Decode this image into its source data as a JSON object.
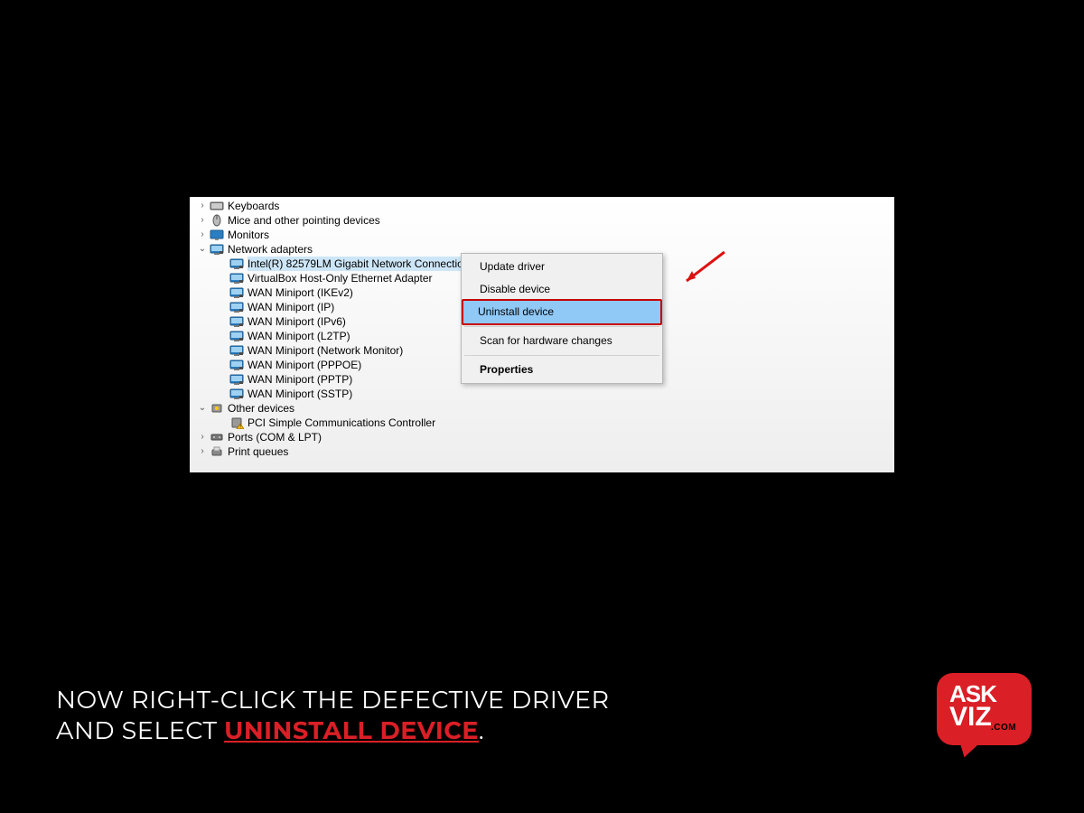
{
  "tree": {
    "items": [
      {
        "label": "Keyboards",
        "expander": "›",
        "indent": 0,
        "icon": "keyboard"
      },
      {
        "label": "Mice and other pointing devices",
        "expander": "›",
        "indent": 0,
        "icon": "mouse"
      },
      {
        "label": "Monitors",
        "expander": "›",
        "indent": 0,
        "icon": "monitor"
      },
      {
        "label": "Network adapters",
        "expander": "⌄",
        "indent": 0,
        "icon": "network"
      },
      {
        "label": "Intel(R) 82579LM Gigabit Network Connection",
        "expander": "",
        "indent": 1,
        "icon": "network",
        "selected": true
      },
      {
        "label": "VirtualBox Host-Only Ethernet Adapter",
        "expander": "",
        "indent": 1,
        "icon": "network"
      },
      {
        "label": "WAN Miniport (IKEv2)",
        "expander": "",
        "indent": 1,
        "icon": "network"
      },
      {
        "label": "WAN Miniport (IP)",
        "expander": "",
        "indent": 1,
        "icon": "network"
      },
      {
        "label": "WAN Miniport (IPv6)",
        "expander": "",
        "indent": 1,
        "icon": "network"
      },
      {
        "label": "WAN Miniport (L2TP)",
        "expander": "",
        "indent": 1,
        "icon": "network"
      },
      {
        "label": "WAN Miniport (Network Monitor)",
        "expander": "",
        "indent": 1,
        "icon": "network"
      },
      {
        "label": "WAN Miniport (PPPOE)",
        "expander": "",
        "indent": 1,
        "icon": "network"
      },
      {
        "label": "WAN Miniport (PPTP)",
        "expander": "",
        "indent": 1,
        "icon": "network"
      },
      {
        "label": "WAN Miniport (SSTP)",
        "expander": "",
        "indent": 1,
        "icon": "network"
      },
      {
        "label": "Other devices",
        "expander": "⌄",
        "indent": 0,
        "icon": "other"
      },
      {
        "label": "PCI Simple Communications Controller",
        "expander": "",
        "indent": 1,
        "icon": "warning"
      },
      {
        "label": "Ports (COM & LPT)",
        "expander": "›",
        "indent": 0,
        "icon": "port"
      },
      {
        "label": "Print queues",
        "expander": "›",
        "indent": 0,
        "icon": "printer"
      }
    ]
  },
  "context_menu": {
    "items": [
      {
        "label": "Update driver",
        "type": "item"
      },
      {
        "label": "Disable device",
        "type": "item"
      },
      {
        "label": "Uninstall device",
        "type": "highlight"
      },
      {
        "type": "sep"
      },
      {
        "label": "Scan for hardware changes",
        "type": "item"
      },
      {
        "type": "sep"
      },
      {
        "label": "Properties",
        "type": "bold"
      }
    ]
  },
  "caption": {
    "line1": "NOW RIGHT-CLICK THE DEFECTIVE DRIVER",
    "line2a": "AND SELECT ",
    "line2b": "UNINSTALL DEVICE",
    "line2c": "."
  },
  "logo": {
    "line1": "ASK",
    "line2": "VIZ",
    "line3": ".COM"
  }
}
